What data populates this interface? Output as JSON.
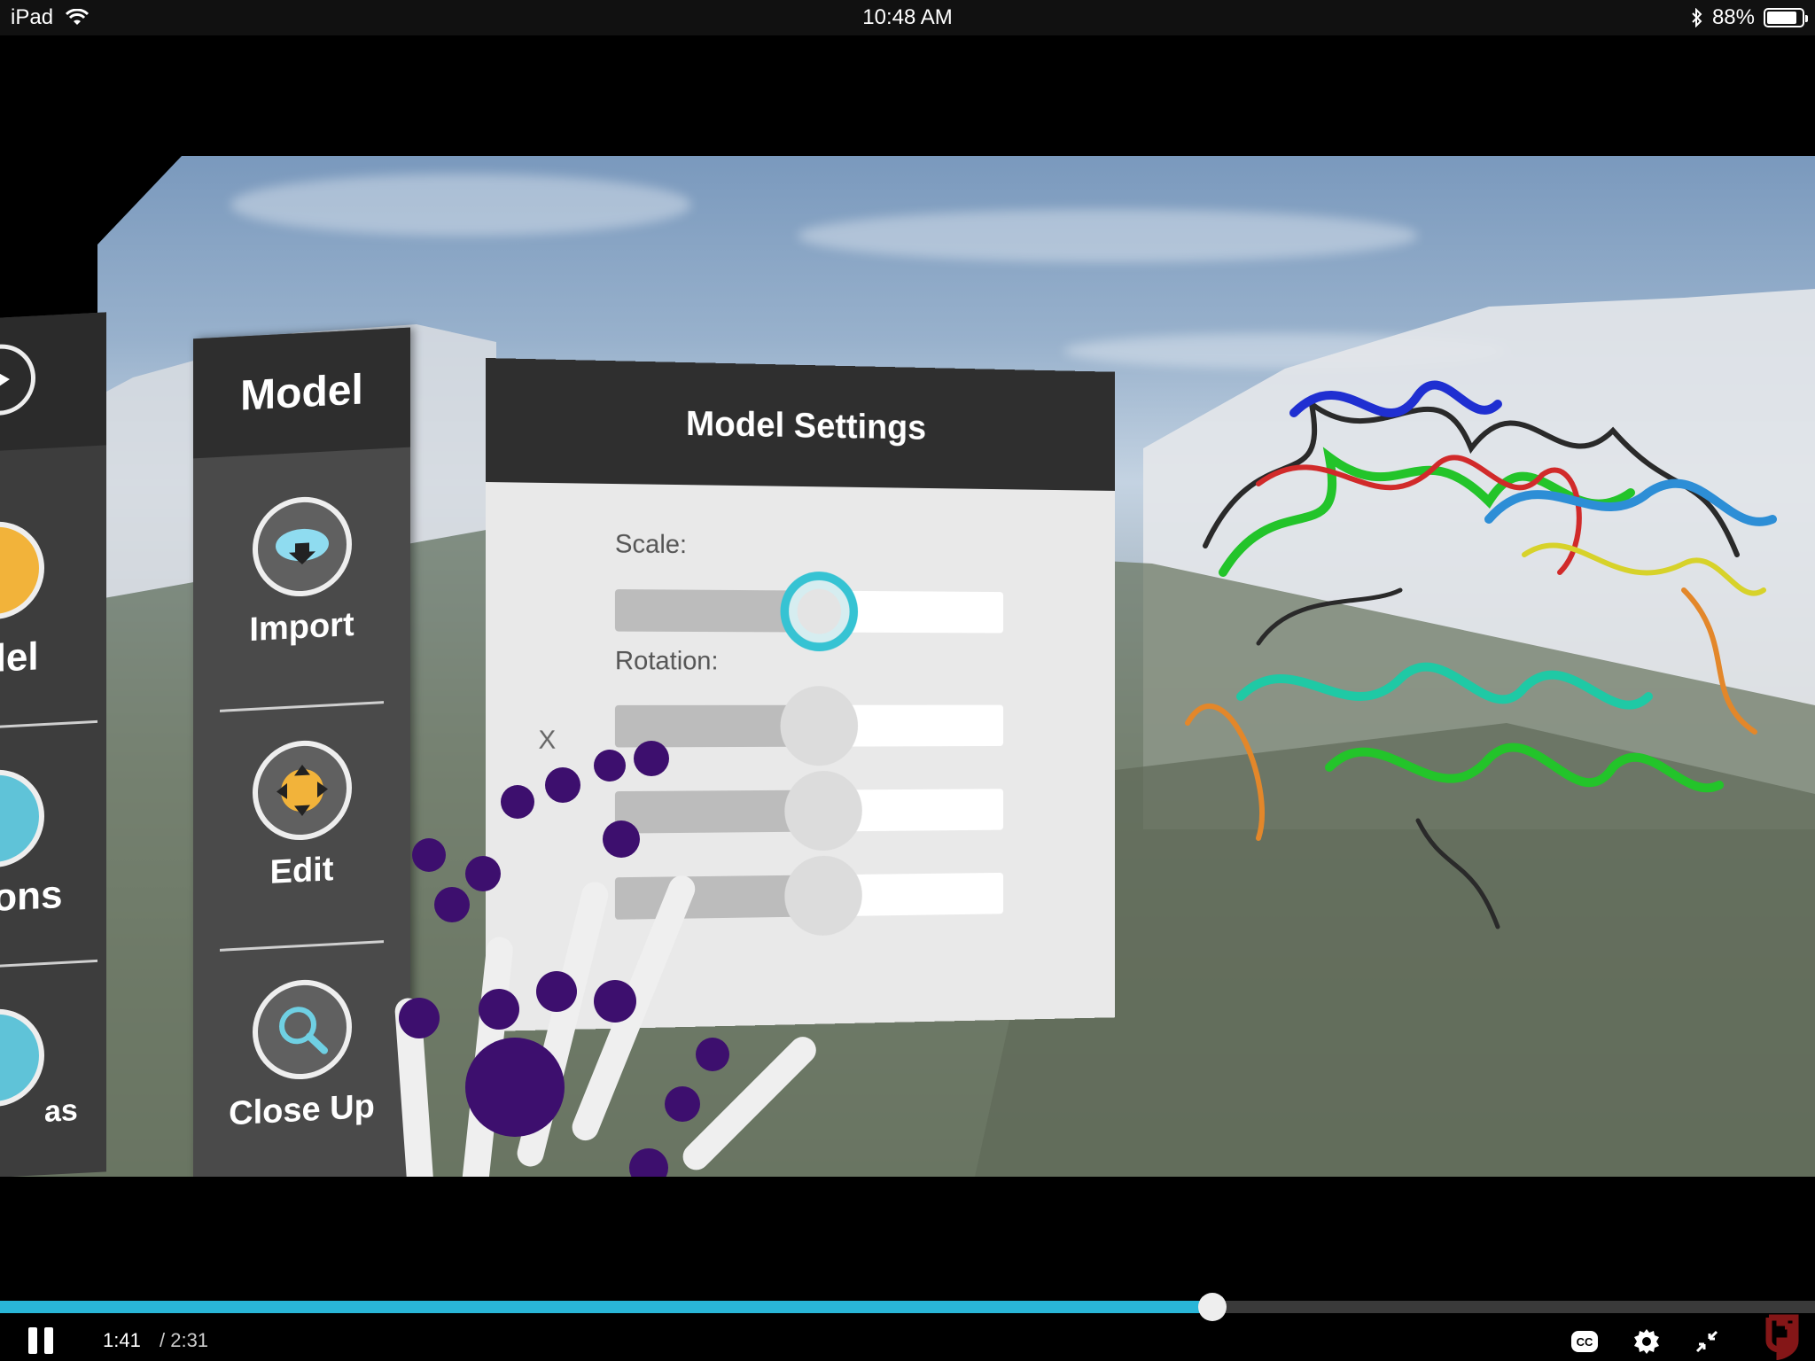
{
  "status_bar": {
    "device": "iPad",
    "time": "10:48 AM",
    "battery": "88%",
    "battery_level": 0.88
  },
  "vr_scene": {
    "left_menu": {
      "items": [
        "del",
        "ions",
        "as"
      ]
    },
    "model_menu": {
      "title": "Model",
      "items": [
        {
          "label": "Import",
          "icon": "cloud-download-icon"
        },
        {
          "label": "Edit",
          "icon": "move-arrows-icon"
        },
        {
          "label": "Close Up",
          "icon": "magnifier-icon"
        }
      ]
    },
    "settings_panel": {
      "title": "Model Settings",
      "close_label": "X",
      "scale_label": "Scale:",
      "rotation_label": "Rotation:",
      "scale_value": 0.52,
      "rotation_values": [
        0.52,
        0.53,
        0.53
      ]
    }
  },
  "player": {
    "current_time": "1:41",
    "duration": "/ 2:31",
    "progress": 0.668,
    "controls": [
      "pause-icon",
      "closed-captions-icon",
      "settings-gear-icon",
      "exit-fullscreen-icon",
      "ou-logo"
    ],
    "colors": {
      "progress": "#29b6d8",
      "accent": "#36c3d3",
      "hand_joint": "#3d0f6e",
      "logo": "#841617"
    }
  }
}
